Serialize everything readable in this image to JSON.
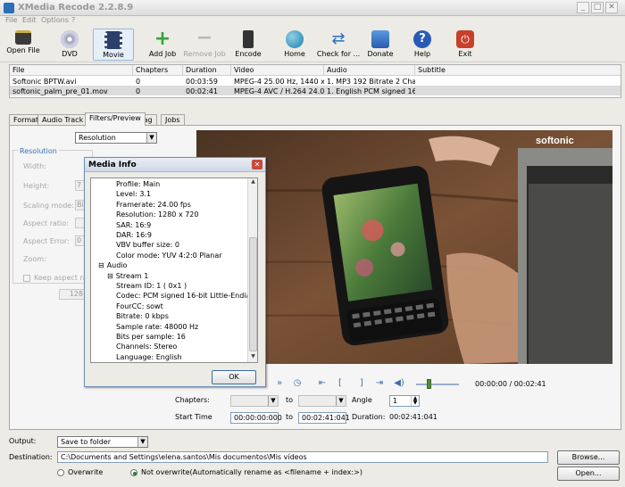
{
  "window": {
    "title": "XMedia Recode 2.2.8.9",
    "min": "_",
    "max": "□",
    "close": "✕"
  },
  "menu": [
    "File",
    "Edit",
    "Options",
    "?"
  ],
  "toolbar": [
    {
      "label": "Open File",
      "icon": "open-file-icon",
      "color": "#3a3a3a"
    },
    {
      "label": "DVD",
      "icon": "dvd-icon",
      "color": "#6c6c8c"
    },
    {
      "label": "Movie",
      "icon": "movie-icon",
      "color": "#2a3f6a"
    },
    {
      "label": "Add Job",
      "icon": "plus-icon",
      "color": "#3aa23a"
    },
    {
      "label": "Remove Job",
      "icon": "minus-icon",
      "color": "#b0b0b0"
    },
    {
      "label": "Encode",
      "icon": "encode-icon",
      "color": "#333333"
    },
    {
      "label": "Home",
      "icon": "globe-icon",
      "color": "#2a8fb0"
    },
    {
      "label": "Check for ...",
      "icon": "refresh-icon",
      "color": "#2a6fc0"
    },
    {
      "label": "Donate",
      "icon": "donate-icon",
      "color": "#3a7ec8"
    },
    {
      "label": "Help",
      "icon": "help-icon",
      "color": "#2a5ab8"
    },
    {
      "label": "Exit",
      "icon": "exit-icon",
      "color": "#c8402a"
    }
  ],
  "filelist": {
    "columns": [
      "File",
      "Chapters",
      "Duration",
      "Video",
      "Audio",
      "Subtitle"
    ],
    "rows": [
      [
        "Softonic BPTW.avi",
        "0",
        "00:03:59",
        "MPEG-4 25.00 Hz, 1440 x ...",
        "1. MP3 192 Bitrate 2 Chan...",
        ""
      ],
      [
        "softonic_palm_pre_01.mov",
        "0",
        "00:02:41",
        "MPEG-4 AVC / H.264 24.0...",
        "1. English PCM signed 16-...",
        ""
      ]
    ]
  },
  "tabs": [
    "Format",
    "Audio Track 1",
    "Filters/Preview",
    "Tag",
    "Jobs"
  ],
  "settings": {
    "mode": "Resolution",
    "group": "Resolution",
    "labels": [
      "Width:",
      "Height:",
      "Scaling mode:",
      "Aspect ratio:",
      "Aspect Error:",
      "Zoom:"
    ],
    "height_prefix": "7",
    "scaling_prefix": "Bi",
    "error_prefix": "0",
    "keep_aspect": "Keep aspect ratio",
    "value_128": "128"
  },
  "video": {
    "watermark": "softonic"
  },
  "dialog": {
    "title": "Media Info",
    "close": "✕",
    "ok": "OK",
    "lines": [
      {
        "indent": 2,
        "text": "Profile: Main"
      },
      {
        "indent": 2,
        "text": "Level: 3.1"
      },
      {
        "indent": 2,
        "text": "Framerate: 24.00 fps"
      },
      {
        "indent": 2,
        "text": "Resolution: 1280 x 720"
      },
      {
        "indent": 2,
        "text": "SAR: 16:9"
      },
      {
        "indent": 2,
        "text": "DAR: 16:9"
      },
      {
        "indent": 2,
        "text": "VBV buffer size: 0"
      },
      {
        "indent": 2,
        "text": "Color mode: YUV 4:2:0 Planar"
      },
      {
        "indent": 0,
        "text": "Audio",
        "toggle": "⊟"
      },
      {
        "indent": 1,
        "text": "Stream 1",
        "toggle": "⊟"
      },
      {
        "indent": 2,
        "text": "Stream ID: 1 ( 0x1 )"
      },
      {
        "indent": 2,
        "text": "Codec: PCM signed 16-bit Little-Endian"
      },
      {
        "indent": 2,
        "text": "FourCC: sowt"
      },
      {
        "indent": 2,
        "text": "Bitrate: 0 kbps"
      },
      {
        "indent": 2,
        "text": "Sample rate: 48000 Hz"
      },
      {
        "indent": 2,
        "text": "Bits per sample: 16"
      },
      {
        "indent": 2,
        "text": "Channels: Stereo"
      },
      {
        "indent": 2,
        "text": "Language: English"
      }
    ]
  },
  "player": {
    "time": "00:00:00 / 00:02:41",
    "position": 0.3
  },
  "chapters": {
    "label": "Chapters:",
    "to": "to",
    "angle_label": "Angle",
    "angle_value": "1",
    "start_label": "Start Time",
    "start_value": "00:00:00:000",
    "end_value": "00:02:41:041",
    "duration_label": "Duration:",
    "duration_value": "00:02:41:041"
  },
  "output": {
    "output_label": "Output:",
    "output_value": "Save to folder",
    "dest_label": "Destination:",
    "dest_value": "C:\\Documents and Settings\\elena.santos\\Mis documentos\\Mis vídeos",
    "browse": "Browse...",
    "open": "Open...",
    "overwrite": "Overwrite",
    "not_overwrite": "Not overwrite(Automatically rename as <filename + index:>)"
  }
}
